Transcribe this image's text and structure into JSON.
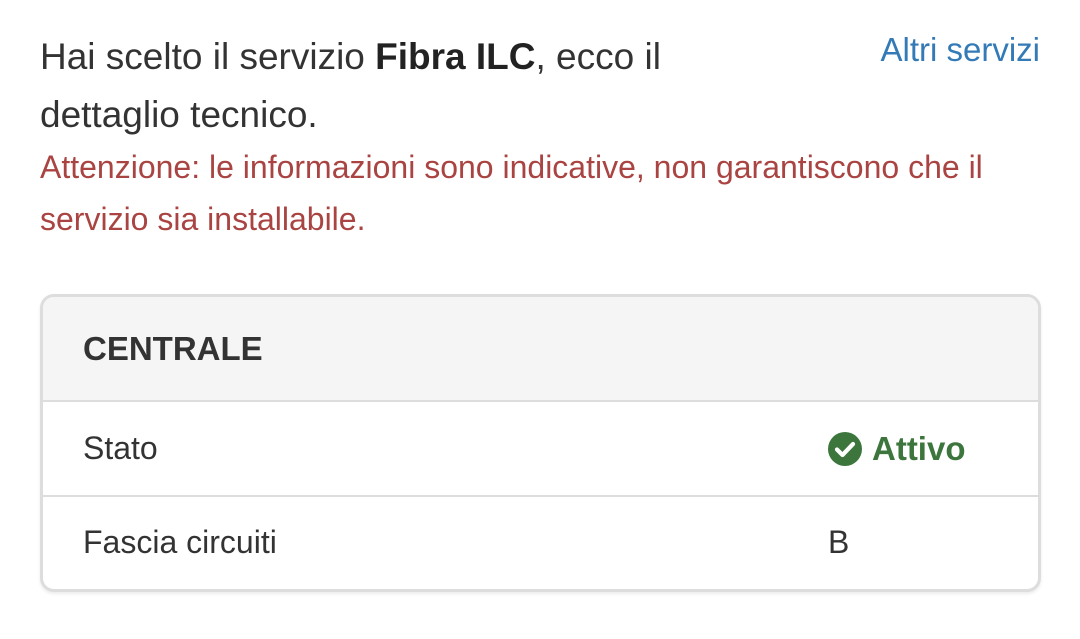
{
  "intro": {
    "prefix": "Hai scelto il servizio ",
    "service_name": "Fibra ILC",
    "suffix": ", ecco il dettaglio tecnico."
  },
  "other_services_link": "Altri servizi",
  "warning": "Attenzione: le informazioni sono indicative, non garantiscono che il servizio sia installabile.",
  "panel": {
    "title": "CENTRALE",
    "rows": [
      {
        "label": "Stato",
        "value": "Attivo",
        "icon": "check-circle-icon",
        "color": "#3c763d"
      },
      {
        "label": "Fascia circuiti",
        "value": "B"
      }
    ]
  },
  "colors": {
    "link": "#337ab7",
    "warning": "#a94442",
    "success": "#3c763d"
  }
}
